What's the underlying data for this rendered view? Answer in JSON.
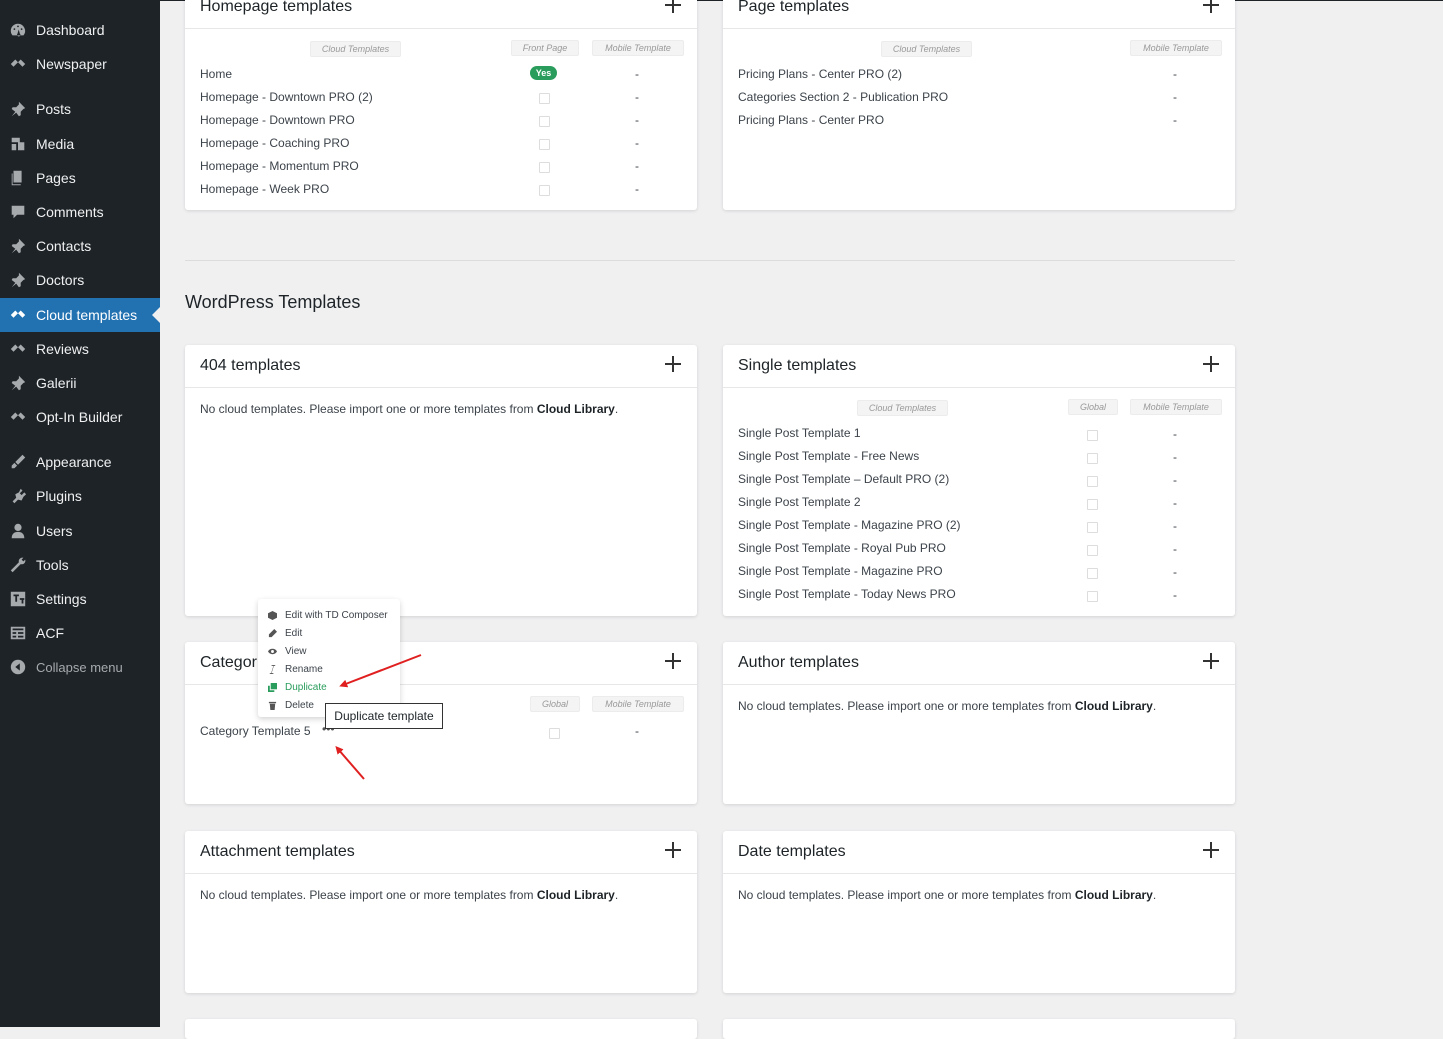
{
  "sidebar": {
    "items": [
      {
        "label": "Dashboard",
        "icon": "dashboard-icon"
      },
      {
        "label": "Newspaper",
        "icon": "newspaper-icon"
      },
      {
        "label": "Posts",
        "icon": "pin-icon"
      },
      {
        "label": "Media",
        "icon": "media-icon"
      },
      {
        "label": "Pages",
        "icon": "pages-icon"
      },
      {
        "label": "Comments",
        "icon": "comments-icon"
      },
      {
        "label": "Contacts",
        "icon": "pin-icon"
      },
      {
        "label": "Doctors",
        "icon": "pin-icon"
      },
      {
        "label": "Cloud templates",
        "icon": "cloud-templates-icon"
      },
      {
        "label": "Reviews",
        "icon": "reviews-icon"
      },
      {
        "label": "Galerii",
        "icon": "pin-icon"
      },
      {
        "label": "Opt-In Builder",
        "icon": "optin-icon"
      },
      {
        "label": "Appearance",
        "icon": "appearance-icon"
      },
      {
        "label": "Plugins",
        "icon": "plugins-icon"
      },
      {
        "label": "Users",
        "icon": "users-icon"
      },
      {
        "label": "Tools",
        "icon": "tools-icon"
      },
      {
        "label": "Settings",
        "icon": "settings-icon"
      },
      {
        "label": "ACF",
        "icon": "acf-icon"
      },
      {
        "label": "Collapse menu",
        "icon": "collapse-icon"
      }
    ],
    "active": "Cloud templates"
  },
  "homepage": {
    "title": "Homepage templates",
    "col_cloud": "Cloud Templates",
    "col_front": "Front Page",
    "col_mobile": "Mobile Template",
    "rows": [
      {
        "name": "Home",
        "front": "Yes",
        "mobile": "-"
      },
      {
        "name": "Homepage - Downtown PRO (2)",
        "mobile": "-"
      },
      {
        "name": "Homepage - Downtown PRO",
        "mobile": "-"
      },
      {
        "name": "Homepage - Coaching PRO",
        "mobile": "-"
      },
      {
        "name": "Homepage - Momentum PRO",
        "mobile": "-"
      },
      {
        "name": "Homepage - Week PRO",
        "mobile": "-"
      }
    ]
  },
  "page": {
    "title": "Page templates",
    "col_cloud": "Cloud Templates",
    "col_mobile": "Mobile Template",
    "rows": [
      {
        "name": "Pricing Plans - Center PRO (2)",
        "mobile": "-"
      },
      {
        "name": "Categories Section 2 - Publication PRO",
        "mobile": "-"
      },
      {
        "name": "Pricing Plans - Center PRO",
        "mobile": "-"
      }
    ]
  },
  "section_title": "WordPress Templates",
  "empty_text": "No cloud templates. Please import one or more templates from ",
  "empty_link": "Cloud Library",
  "empty_end": ".",
  "t404": {
    "title": "404 templates"
  },
  "single": {
    "title": "Single templates",
    "col_cloud": "Cloud Templates",
    "col_global": "Global",
    "col_mobile": "Mobile Template",
    "rows": [
      {
        "name": "Single Post Template 1",
        "mobile": "-"
      },
      {
        "name": "Single Post Template - Free News",
        "mobile": "-"
      },
      {
        "name": "Single Post Template – Default PRO (2)",
        "mobile": "-"
      },
      {
        "name": "Single Post Template 2",
        "mobile": "-"
      },
      {
        "name": "Single Post Template - Magazine PRO (2)",
        "mobile": "-"
      },
      {
        "name": "Single Post Template - Royal Pub PRO",
        "mobile": "-"
      },
      {
        "name": "Single Post Template - Magazine PRO",
        "mobile": "-"
      },
      {
        "name": "Single Post Template - Today News PRO",
        "mobile": "-"
      }
    ]
  },
  "category": {
    "title": "Categor",
    "col_global": "Global",
    "col_mobile": "Mobile Template",
    "rows": [
      {
        "name": "Category Template 5",
        "mobile": "-"
      }
    ],
    "dots": "•••"
  },
  "author": {
    "title": "Author templates"
  },
  "attachment": {
    "title": "Attachment templates"
  },
  "date": {
    "title": "Date templates"
  },
  "context_menu": [
    {
      "label": "Edit with TD Composer",
      "icon": "composer-icon"
    },
    {
      "label": "Edit",
      "icon": "pencil-icon"
    },
    {
      "label": "View",
      "icon": "eye-icon"
    },
    {
      "label": "Rename",
      "icon": "text-cursor-icon"
    },
    {
      "label": "Duplicate",
      "icon": "duplicate-icon"
    },
    {
      "label": "Delete",
      "icon": "trash-icon"
    }
  ],
  "tooltip": "Duplicate template",
  "colors": {
    "sidebar": "#1d2327",
    "accent": "#2271b1",
    "green": "#2a9d5c",
    "arrow": "#e02020"
  }
}
